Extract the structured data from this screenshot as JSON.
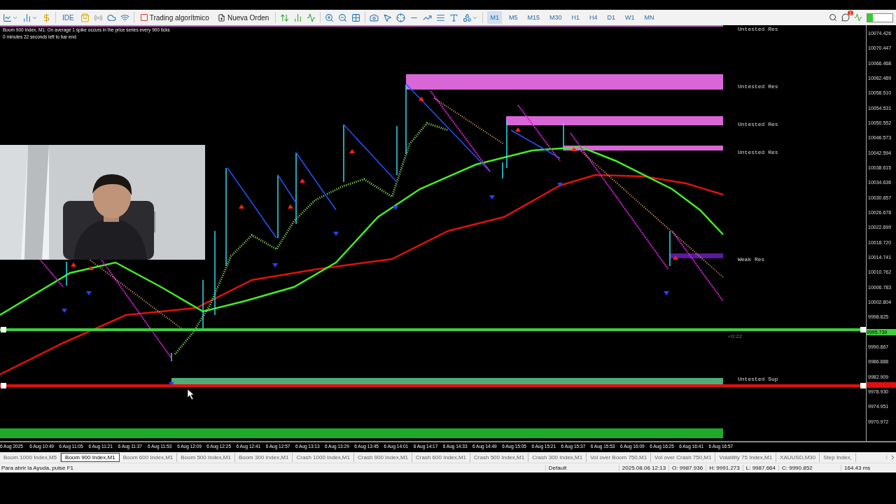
{
  "toolbar": {
    "ide_label": "IDE",
    "algo_trading": "Trading algorítmico",
    "new_order": "Nueva Orden",
    "timeframes": [
      {
        "label": "M1",
        "selected": true
      },
      {
        "label": "M5",
        "selected": false
      },
      {
        "label": "M15",
        "selected": false
      },
      {
        "label": "M30",
        "selected": false
      },
      {
        "label": "H1",
        "selected": false
      },
      {
        "label": "H4",
        "selected": false
      },
      {
        "label": "D1",
        "selected": false
      },
      {
        "label": "W1",
        "selected": false
      },
      {
        "label": "MN",
        "selected": false
      }
    ],
    "notification_count": "1"
  },
  "chart": {
    "header": "Boom 900 Index, M1:  On average 1 spike occurs in the price series every 900 ticks",
    "countdown": "0 minutes 22 seconds left to bar end",
    "zones": [
      {
        "label": "Untested Res",
        "color": "#d966d6"
      },
      {
        "label": "Untested Res",
        "color": "#d966d6"
      },
      {
        "label": "Untested Res",
        "color": "#d966d6"
      },
      {
        "label": "Untested Res",
        "color": "#d966d6"
      },
      {
        "label": "Weak Res",
        "color": "#5b1a9c"
      },
      {
        "label": "Untested Sup",
        "color": "#4caf78"
      }
    ],
    "timer_label": "<0:22",
    "price_axis_upper": [
      "10074.426",
      "10070.447",
      "10066.468",
      "10062.489",
      "10058.510",
      "10054.531",
      "10050.552",
      "10046.573",
      "10042.594",
      "10038.615",
      "10034.636",
      "10030.657",
      "10026.678",
      "10022.699",
      "10018.720",
      "10014.741",
      "10010.762",
      "10006.783",
      "10002.804",
      "9998.825"
    ],
    "price_axis_lower": [
      "9990.867",
      "9986.888",
      "9982.909",
      "9978.930",
      "9974.951",
      "9970.972"
    ],
    "bid_tag": "9995.739",
    "time_axis": [
      "6 Aug 2025",
      "6 Aug 10:49",
      "6 Aug 11:05",
      "6 Aug 11:21",
      "6 Aug 11:37",
      "6 Aug 11:53",
      "6 Aug 12:09",
      "6 Aug 12:25",
      "6 Aug 12:41",
      "6 Aug 12:57",
      "6 Aug 13:13",
      "6 Aug 13:29",
      "6 Aug 13:45",
      "6 Aug 14:01",
      "6 Aug 14:17",
      "6 Aug 14:33",
      "6 Aug 14:49",
      "6 Aug 15:05",
      "6 Aug 15:21",
      "6 Aug 15:37",
      "6 Aug 15:53",
      "6 Aug 16:09",
      "6 Aug 16:25",
      "6 Aug 16:41",
      "6 Aug 16:57"
    ]
  },
  "symbol_tabs": [
    {
      "label": "Boom 1000 Index,M5",
      "selected": false
    },
    {
      "label": "Boom 900 Index,M1",
      "selected": true
    },
    {
      "label": "Boom 600 Index,M1",
      "selected": false
    },
    {
      "label": "Boom 500 Index,M1",
      "selected": false
    },
    {
      "label": "Boom 300 Index,M1",
      "selected": false
    },
    {
      "label": "Crash 1000 Index,M1",
      "selected": false
    },
    {
      "label": "Crash 900 Index,M1",
      "selected": false
    },
    {
      "label": "Crash 600 Index,M1",
      "selected": false
    },
    {
      "label": "Crash 500 Index,M1",
      "selected": false
    },
    {
      "label": "Crash 300 Index,M1",
      "selected": false
    },
    {
      "label": "Vol over Boom 750,M1",
      "selected": false
    },
    {
      "label": "Vol over Crash 750,M1",
      "selected": false
    },
    {
      "label": "Volatility 75 Index,M1",
      "selected": false
    },
    {
      "label": "XAUUSD,M30",
      "selected": false
    },
    {
      "label": "Step Index,",
      "selected": false
    }
  ],
  "status_bar": {
    "help": "Para abrir la Ayuda, pulse F1",
    "profile": "Default",
    "time": "2025.08.06 12:13",
    "open": "O: 9987.936",
    "high": "H: 9991.273",
    "low": "L: 9987.664",
    "close": "C: 9990.852",
    "ping": "164.43 ms"
  }
}
